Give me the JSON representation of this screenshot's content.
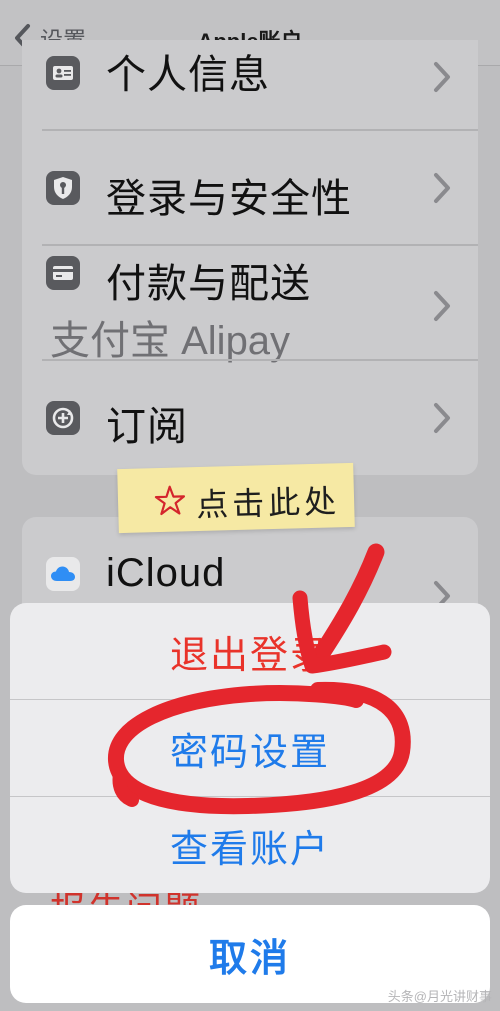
{
  "navbar": {
    "back_label": "设置",
    "title": "Apple账户"
  },
  "settings_group_1": [
    {
      "label": "个人信息",
      "icon": "person-card-icon"
    },
    {
      "label": "登录与安全性",
      "icon": "shield-key-icon"
    },
    {
      "label": "付款与配送",
      "sub": "支付宝 Alipay",
      "icon": "credit-card-icon"
    },
    {
      "label": "订阅",
      "icon": "subscription-icon"
    }
  ],
  "settings_group_2": [
    {
      "label": "iCloud",
      "icon": "icloud-icon"
    }
  ],
  "annotation": {
    "note": "点击此处",
    "highlight_color": "#e5262d",
    "note_color": "#f6e9a4"
  },
  "action_sheet": {
    "sign_out": "退出登录",
    "password_settings": "密码设置",
    "view_account": "查看账户",
    "cancel": "取消",
    "peek_text": "报告问题"
  },
  "colors": {
    "destructive": "#e9332a",
    "action": "#1f7bea"
  },
  "watermark": "头条@月光讲财事"
}
